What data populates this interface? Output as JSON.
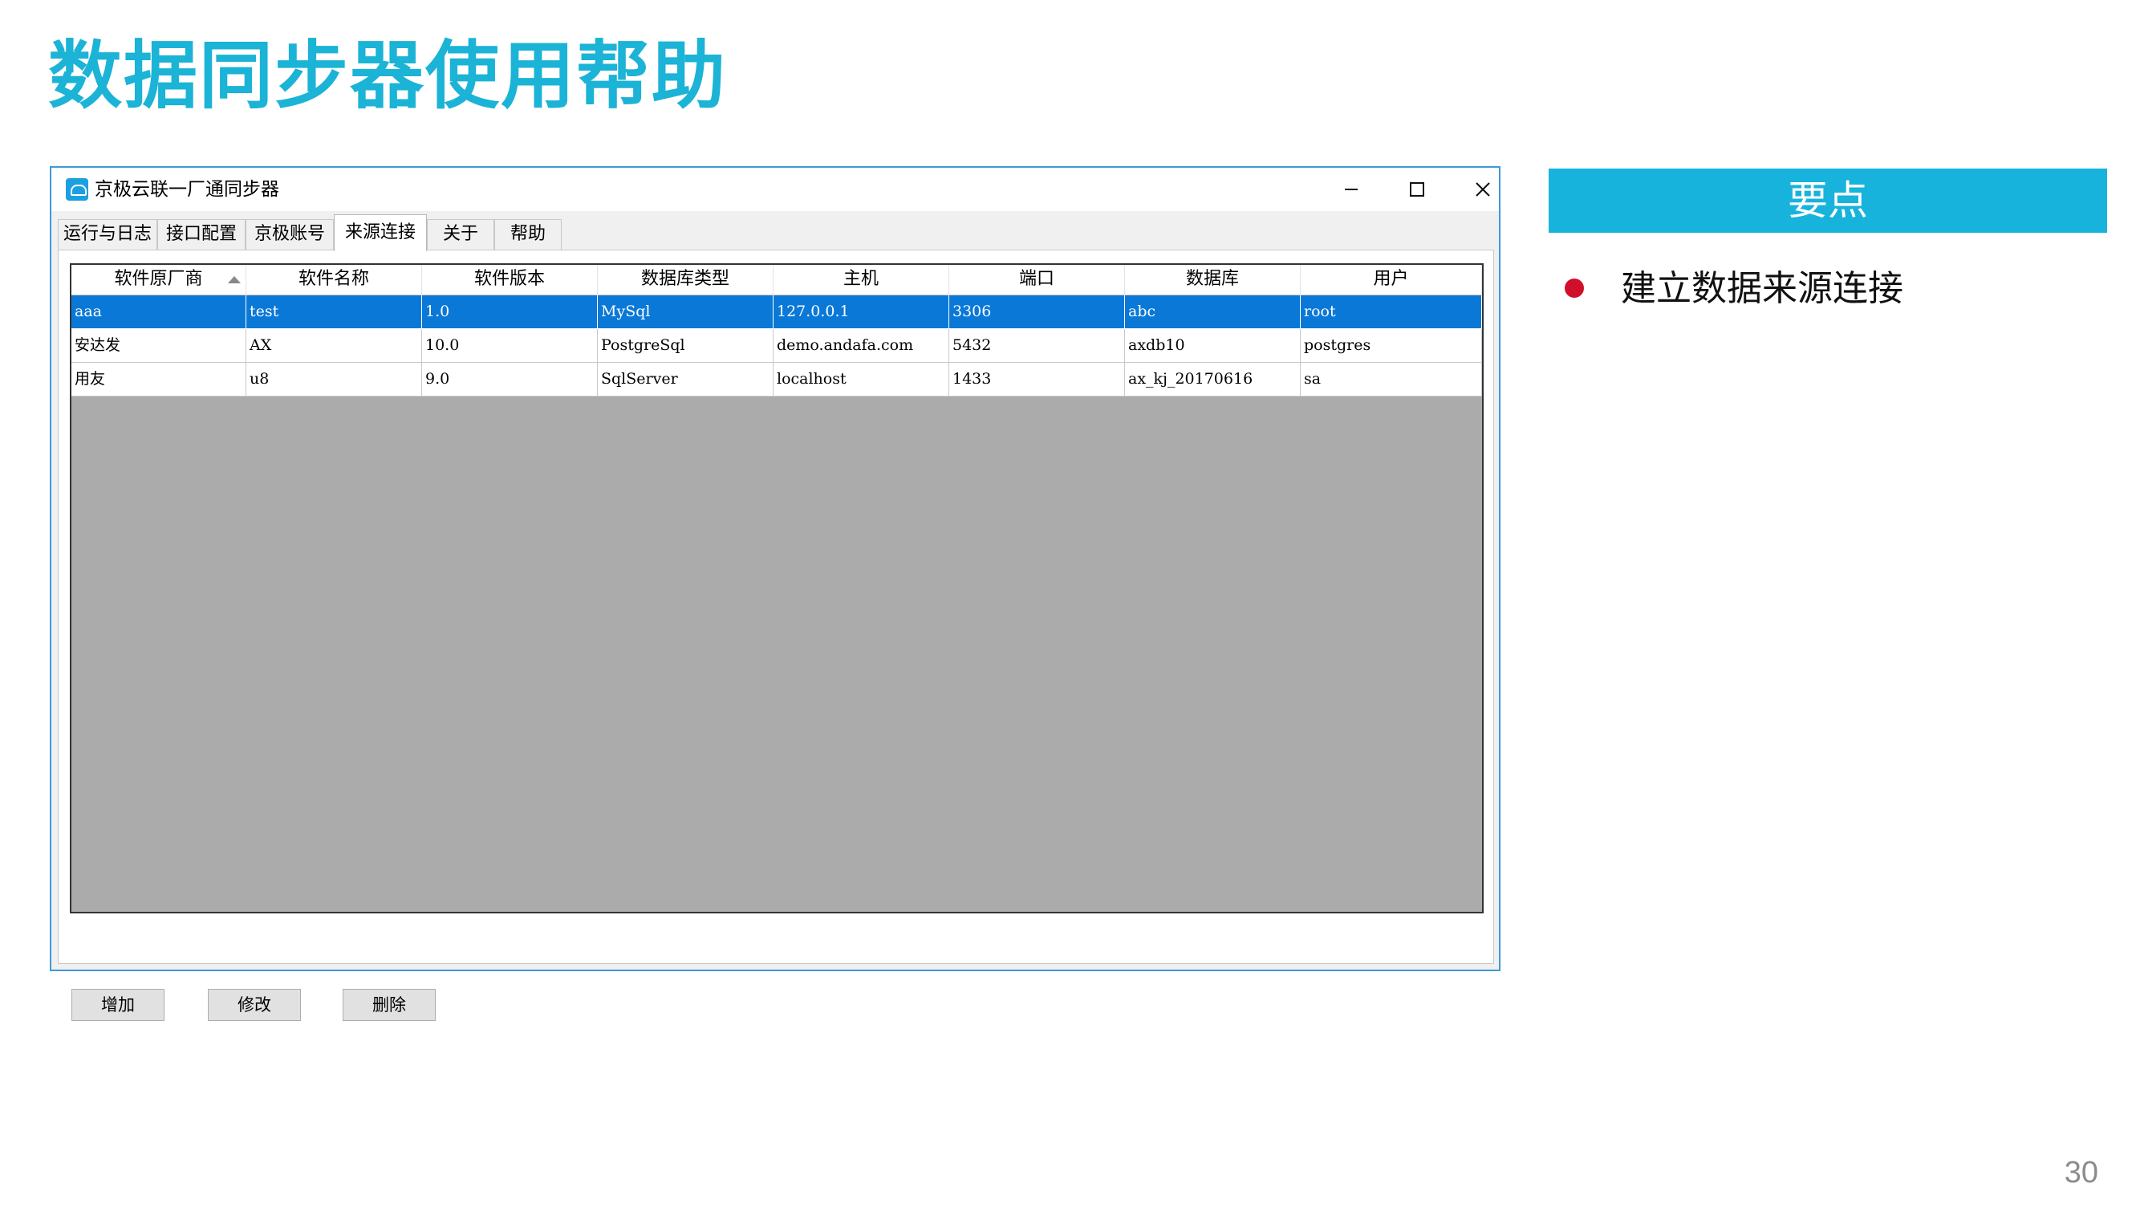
{
  "slide": {
    "title": "数据同步器使用帮助",
    "page_number": "30"
  },
  "window": {
    "title": "京极云联一厂通同步器",
    "controls": {
      "minimize": "minimize-icon",
      "maximize": "maximize-icon",
      "close": "close-icon"
    },
    "tabs": [
      {
        "label": "运行与日志"
      },
      {
        "label": "接口配置"
      },
      {
        "label": "京极账号"
      },
      {
        "label": "来源连接"
      },
      {
        "label": "关于"
      },
      {
        "label": "帮助"
      }
    ],
    "active_tab": "来源连接",
    "table": {
      "columns": [
        "软件原厂商",
        "软件名称",
        "软件版本",
        "数据库类型",
        "主机",
        "端口",
        "数据库",
        "用户"
      ],
      "sorted_column": "软件原厂商",
      "rows": [
        [
          "aaa",
          "test",
          "1.0",
          "MySql",
          "127.0.0.1",
          "3306",
          "abc",
          "root"
        ],
        [
          "安达发",
          "AX",
          "10.0",
          "PostgreSql",
          "demo.andafa.com",
          "5432",
          "axdb10",
          "postgres"
        ],
        [
          "用友",
          "u8",
          "9.0",
          "SqlServer",
          "localhost",
          "1433",
          "ax_kj_20170616",
          "sa"
        ]
      ],
      "selected_row": 0
    },
    "buttons": {
      "add": "增加",
      "edit": "修改",
      "delete": "删除"
    }
  },
  "panel": {
    "header": "要点",
    "bullets": [
      "建立数据来源连接"
    ]
  },
  "colors": {
    "title": "#1bb3d6",
    "panel_header": "#17b3dc",
    "selection": "#0a78d7",
    "bullet": "#d0102a",
    "window_border": "#3c9ad9"
  }
}
